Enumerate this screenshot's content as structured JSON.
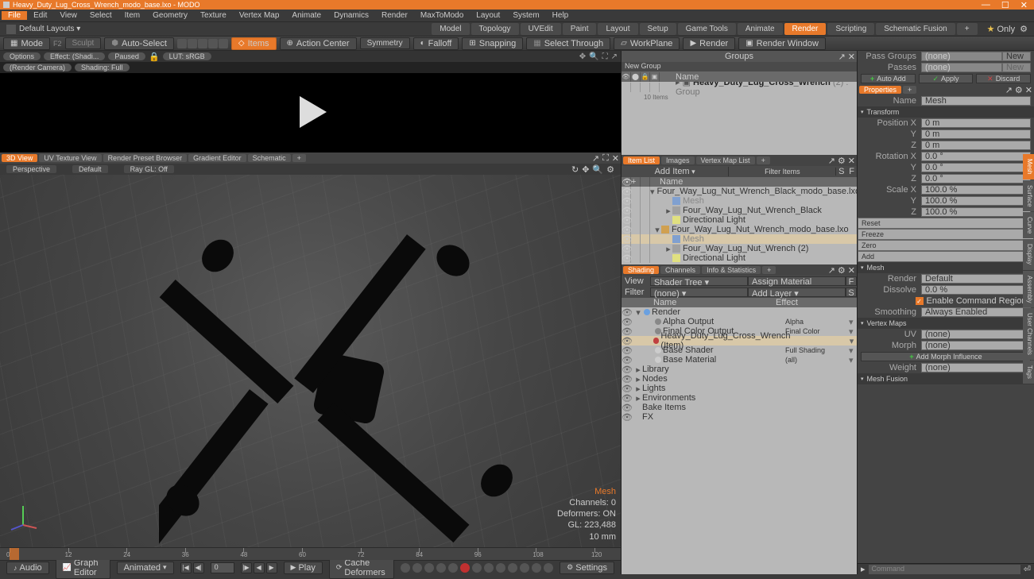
{
  "window": {
    "title": "Heavy_Duty_Lug_Cross_Wrench_modo_base.lxo - MODO"
  },
  "menu": [
    "File",
    "Edit",
    "View",
    "Select",
    "Item",
    "Geometry",
    "Texture",
    "Vertex Map",
    "Animate",
    "Dynamics",
    "Render",
    "MaxToModo",
    "Layout",
    "System",
    "Help"
  ],
  "layout": {
    "default": "Default Layouts ▾",
    "tabs": [
      "Model",
      "Topology",
      "UVEdit",
      "Paint",
      "Layout",
      "Setup",
      "Game Tools",
      "Animate",
      "Render",
      "Scripting",
      "Schematic Fusion"
    ],
    "only": "Only"
  },
  "tools": {
    "mode": "Mode",
    "sculpt": "Sculpt",
    "auto_select": "Auto-Select",
    "items": "Items",
    "action_center": "Action Center",
    "symmetry": "Symmetry",
    "falloff": "Falloff",
    "snapping": "Snapping",
    "select_through": "Select Through",
    "workplane": "WorkPlane",
    "render": "Render",
    "render_window": "Render Window"
  },
  "preview": {
    "options": "Options",
    "effect": "Effect: (Shadi...",
    "paused": "Paused",
    "lut": "LUT: sRGB",
    "camera": "(Render Camera)",
    "shading": "Shading: Full"
  },
  "viewport_tabs": [
    "3D View",
    "UV Texture View",
    "Render Preset Browser",
    "Gradient Editor",
    "Schematic"
  ],
  "viewport_ctrls": {
    "perspective": "Perspective",
    "default": "Default",
    "raygl": "Ray GL: Off"
  },
  "viewport_info": {
    "mesh": "Mesh",
    "channels": "Channels: 0",
    "deformers": "Deformers: ON",
    "gl": "GL: 223,488",
    "unit": "10 mm"
  },
  "timeline": {
    "ticks": [
      0,
      12,
      24,
      36,
      48,
      60,
      72,
      84,
      96,
      108,
      120
    ],
    "current": 0
  },
  "transport": {
    "audio": "Audio",
    "graph": "Graph Editor",
    "animated": "Animated",
    "frame": "0",
    "play": "Play",
    "cache": "Cache Deformers",
    "settings": "Settings"
  },
  "groups": {
    "title": "Groups",
    "new": "New Group",
    "name_col": "Name",
    "item": "Heavy_Duty_Lug_Cross_Wrench",
    "item_suffix": "(2) : Group",
    "count": "10 Items"
  },
  "itemlist": {
    "tabs": [
      "Item List",
      "Images",
      "Vertex Map List"
    ],
    "add": "Add Item",
    "filter": "Filter Items",
    "name_col": "Name",
    "rows": [
      {
        "indent": 0,
        "expand": "▾",
        "icon": "scene",
        "label": "Four_Way_Lug_Nut_Wrench_Black_modo_base.lxo*"
      },
      {
        "indent": 1,
        "icon": "mesh",
        "label": "Mesh",
        "gray": true
      },
      {
        "indent": 1,
        "expand": "▸",
        "icon": "group",
        "label": "Four_Way_Lug_Nut_Wrench_Black"
      },
      {
        "indent": 1,
        "icon": "light",
        "label": "Directional Light"
      },
      {
        "indent": 0,
        "expand": "▾",
        "icon": "scene",
        "label": "Four_Way_Lug_Nut_Wrench_modo_base.lxo"
      },
      {
        "indent": 1,
        "icon": "mesh",
        "label": "Mesh",
        "gray": true,
        "sel": true
      },
      {
        "indent": 1,
        "expand": "▸",
        "icon": "group",
        "label": "Four_Way_Lug_Nut_Wrench (2)",
        "gray_suffix": true
      },
      {
        "indent": 1,
        "icon": "light",
        "label": "Directional Light"
      }
    ]
  },
  "shading": {
    "tabs": [
      "Shading",
      "Channels",
      "Info & Statistics"
    ],
    "view_label": "View",
    "view": "Shader Tree",
    "assign": "Assign Material",
    "filter_label": "Filter",
    "filter": "(none)",
    "addlayer": "Add Layer",
    "name_col": "Name",
    "effect_col": "Effect",
    "rows": [
      {
        "indent": 0,
        "expand": "▾",
        "dot": "#6aa0e0",
        "label": "Render",
        "effect": ""
      },
      {
        "indent": 1,
        "dot": "#888",
        "label": "Alpha Output",
        "effect": "Alpha",
        "dd": true
      },
      {
        "indent": 1,
        "dot": "#888",
        "label": "Final Color Output",
        "effect": "Final Color",
        "dd": true
      },
      {
        "indent": 1,
        "dot": "#c04040",
        "label": "Heavy_Duty_Lug_Cross_Wrench (Item)",
        "effect": "",
        "sel": true,
        "dd": true
      },
      {
        "indent": 1,
        "dot": "#ccc",
        "label": "Base Shader",
        "effect": "Full Shading",
        "dd": true
      },
      {
        "indent": 1,
        "dot": "#ccc",
        "label": "Base Material",
        "effect": "(all)",
        "dd": true
      },
      {
        "indent": 0,
        "expand": "▸",
        "label": "Library",
        "effect": ""
      },
      {
        "indent": 0,
        "expand": "▸",
        "label": "Nodes",
        "effect": ""
      },
      {
        "indent": 0,
        "expand": "▸",
        "label": "Lights",
        "effect": ""
      },
      {
        "indent": 0,
        "expand": "▸",
        "label": "Environments",
        "effect": ""
      },
      {
        "indent": 0,
        "label": "Bake Items",
        "effect": ""
      },
      {
        "indent": 0,
        "label": "FX",
        "effect": ""
      }
    ]
  },
  "right": {
    "pass_groups": "Pass Groups",
    "pass_groups_val": "(none)",
    "new": "New",
    "passes": "Passes",
    "passes_val": "(none)",
    "auto_add": "Auto Add",
    "apply": "Apply",
    "discard": "Discard",
    "properties": "Properties",
    "name_label": "Name",
    "name_val": "Mesh",
    "transform": "Transform",
    "pos": {
      "x": "0 m",
      "y": "0 m",
      "z": "0 m",
      "xlabel": "Position X",
      "ylabel": "Y",
      "zlabel": "Z"
    },
    "rot": {
      "x": "0.0 °",
      "y": "0.0 °",
      "z": "0.0 °",
      "xlabel": "Rotation X",
      "ylabel": "Y",
      "zlabel": "Z"
    },
    "scale": {
      "x": "100.0 %",
      "y": "100.0 %",
      "z": "100.0 %",
      "xlabel": "Scale X",
      "ylabel": "Y",
      "zlabel": "Z"
    },
    "actions": [
      "Reset",
      "Freeze",
      "Zero",
      "Add"
    ],
    "mesh_section": "Mesh",
    "render_label": "Render",
    "render_val": "Default",
    "dissolve_label": "Dissolve",
    "dissolve_val": "0.0 %",
    "enable_cmd": "Enable Command Regions",
    "smoothing_label": "Smoothing",
    "smoothing_val": "Always Enabled",
    "vertex_maps": "Vertex Maps",
    "uv_label": "UV",
    "uv_val": "(none)",
    "morph_label": "Morph",
    "morph_val": "(none)",
    "add_morph": "Add Morph Influence",
    "weight_label": "Weight",
    "weight_val": "(none)",
    "mesh_fusion": "Mesh Fusion",
    "vtabs": [
      "Mesh",
      "Surface",
      "Curve",
      "Display",
      "Assembly",
      "User Channels",
      "Tags"
    ],
    "command": "Command"
  }
}
